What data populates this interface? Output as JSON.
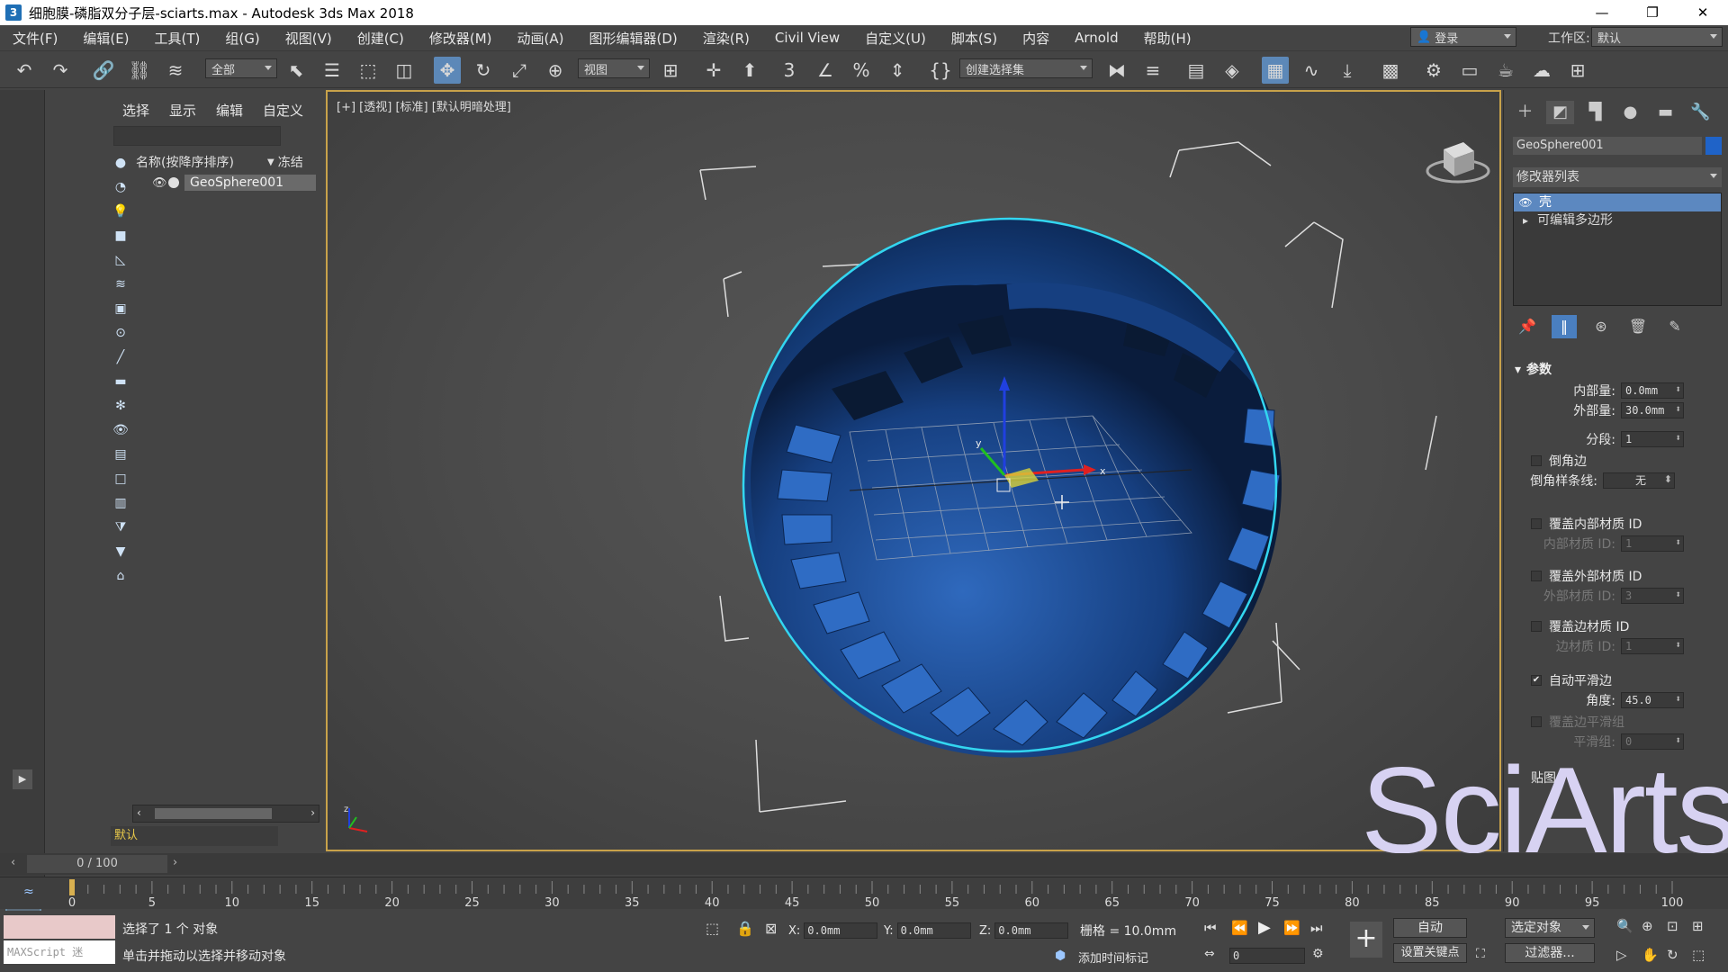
{
  "window": {
    "title": "细胞膜-磷脂双分子层-sciarts.max - Autodesk 3ds Max 2018",
    "buttons": [
      "—",
      "❐",
      "✕"
    ]
  },
  "menu": [
    "文件(F)",
    "编辑(E)",
    "工具(T)",
    "组(G)",
    "视图(V)",
    "创建(C)",
    "修改器(M)",
    "动画(A)",
    "图形编辑器(D)",
    "渲染(R)",
    "Civil View",
    "自定义(U)",
    "脚本(S)",
    "内容",
    "Arnold",
    "帮助(H)"
  ],
  "login": "登录",
  "workspace": {
    "label": "工作区:",
    "value": "默认"
  },
  "toolbar": {
    "selection_filter": "全部",
    "ref_coord": "视图",
    "named_selection": "创建选择集"
  },
  "explorer": {
    "tabs": [
      "选择",
      "显示",
      "编辑",
      "自定义"
    ],
    "column_name": "名称(按降序排序)",
    "column_frozen": "冻结",
    "objects": [
      "GeoSphere001"
    ],
    "layer": "默认"
  },
  "viewport": {
    "label": "[+] [透视] [标准] [默认明暗处理]",
    "sphere_color": "#1c4f9a",
    "highlight_color": "#33d6f0",
    "axis_labels": {
      "x": "x",
      "y": "y",
      "z": "z"
    }
  },
  "command_panel": {
    "object_name": "GeoSphere001",
    "object_color": "#1f63c8",
    "modifier_list": "修改器列表",
    "modifiers": [
      "壳",
      "可编辑多边形"
    ],
    "rollout": "参数",
    "params": {
      "inner_label": "内部量:",
      "inner_value": "0.0mm",
      "outer_label": "外部量:",
      "outer_value": "30.0mm",
      "segments_label": "分段:",
      "segments_value": "1",
      "bevel_edges": "倒角边",
      "bevel_spline_label": "倒角样条线:",
      "bevel_spline_value": "无",
      "override_inner": "覆盖内部材质 ID",
      "inner_mat_label": "内部材质 ID:",
      "inner_mat_value": "1",
      "override_outer": "覆盖外部材质 ID",
      "outer_mat_label": "外部材质 ID:",
      "outer_mat_value": "3",
      "override_edge": "覆盖边材质 ID",
      "edge_mat_label": "边材质 ID:",
      "edge_mat_value": "1",
      "auto_smooth": "自动平滑边",
      "angle_label": "角度:",
      "angle_value": "45.0",
      "override_smooth": "覆盖边平滑组",
      "smooth_label": "平滑组:",
      "smooth_value": "0",
      "mapping": "贴图"
    }
  },
  "timeline": {
    "frame_label": "0 / 100",
    "ticks": [
      "0",
      "5",
      "10",
      "15",
      "20",
      "25",
      "30",
      "35",
      "40",
      "45",
      "50",
      "55",
      "60",
      "65",
      "70",
      "75",
      "80",
      "85",
      "90",
      "95",
      "100"
    ]
  },
  "status": {
    "maxscript": "MAXScript 迷",
    "selected": "选择了 1 个 对象",
    "prompt": "单击并拖动以选择并移动对象",
    "x_label": "X:",
    "x_value": "0.0mm",
    "y_label": "Y:",
    "y_value": "0.0mm",
    "z_label": "Z:",
    "z_value": "0.0mm",
    "grid": "栅格 = 10.0mm",
    "add_time_tag": "添加时间标记",
    "auto_key": "自动",
    "set_key": "设置关键点",
    "key_filter": "选定对象",
    "filters": "过滤器...",
    "current_frame": "0"
  },
  "watermark": "SciArts"
}
